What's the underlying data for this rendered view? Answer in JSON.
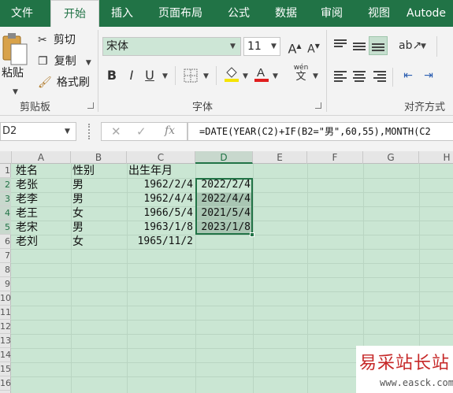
{
  "ribbon_tabs": [
    "文件",
    "开始",
    "插入",
    "页面布局",
    "公式",
    "数据",
    "审阅",
    "视图",
    "Autode"
  ],
  "active_tab": "开始",
  "clipboard": {
    "paste_label": "粘贴",
    "cut_label": "剪切",
    "copy_label": "复制",
    "format_painter_label": "格式刷",
    "group_label": "剪贴板"
  },
  "font": {
    "name": "宋体",
    "size": "11",
    "bold": "B",
    "italic": "I",
    "underline": "U",
    "phonetic": "wén",
    "group_label": "字体",
    "font_color": "#e01e1e",
    "fill_color": "#f5e400"
  },
  "alignment": {
    "group_label": "对齐方式"
  },
  "formula_bar": {
    "name_box": "D2",
    "cancel": "✕",
    "enter": "✓",
    "fx": "fx",
    "formula": "=DATE(YEAR(C2)+IF(B2=\"男\",60,55),MONTH(C2"
  },
  "columns": [
    "A",
    "B",
    "C",
    "D",
    "E",
    "F",
    "G",
    "H"
  ],
  "selected_column": "D",
  "rows": [
    "1",
    "2",
    "3",
    "4",
    "5",
    "6",
    "7",
    "8",
    "9",
    "10",
    "11",
    "12",
    "13",
    "14",
    "15",
    "16"
  ],
  "sheet": {
    "header": [
      "姓名",
      "性别",
      "出生年月"
    ],
    "records": [
      {
        "name": "老张",
        "gender": "男",
        "birth": "1962/2/4",
        "retire": "2022/2/4"
      },
      {
        "name": "老李",
        "gender": "男",
        "birth": "1962/4/4",
        "retire": "2022/4/4"
      },
      {
        "name": "老王",
        "gender": "女",
        "birth": "1966/5/4",
        "retire": "2021/5/4"
      },
      {
        "name": "老宋",
        "gender": "男",
        "birth": "1963/1/8",
        "retire": "2023/1/8"
      },
      {
        "name": "老刘",
        "gender": "女",
        "birth": "1965/11/2",
        "retire": ""
      }
    ]
  },
  "watermark": {
    "title": "易采站长站",
    "url": "www.easck.com"
  },
  "colors": {
    "brand": "#217346",
    "grid_bg": "#cae6d3"
  }
}
